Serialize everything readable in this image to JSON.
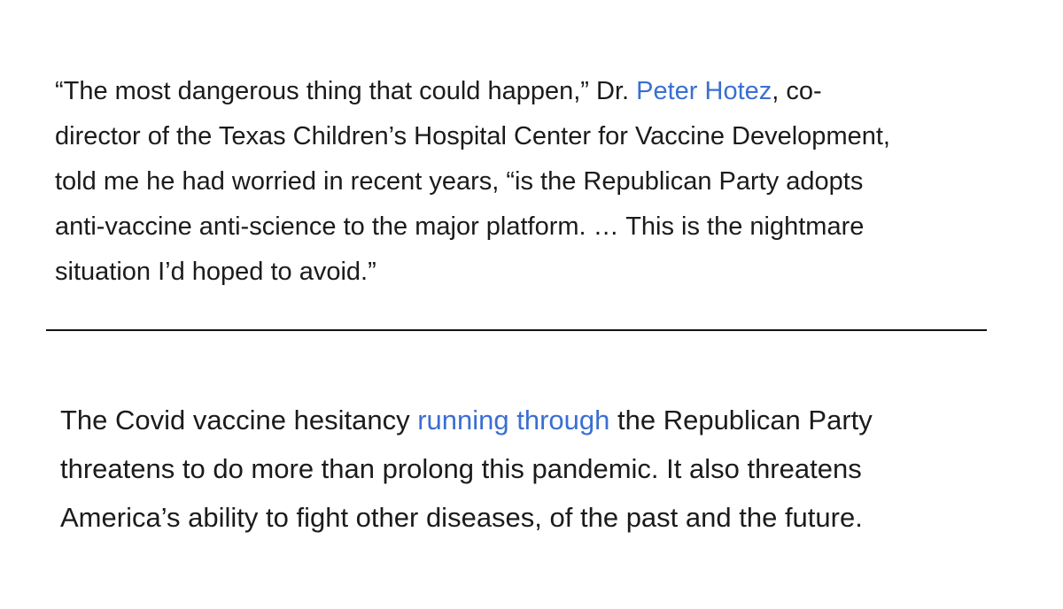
{
  "quote_paragraph": {
    "line1": {
      "before_link": "“The most dangerous thing that could happen,” Dr. ",
      "link": "Peter Hotez",
      "after_link": ", co-"
    },
    "line2": "director of the Texas Children’s Hospital Center for Vaccine Development,",
    "line3": "told me he had worried in recent years, “is the Republican Party adopts",
    "line4": "anti-vaccine anti-science to the major platform. … This is the nightmare",
    "line5": "situation I’d hoped to avoid.”"
  },
  "body_paragraph": {
    "line1": {
      "before_link": "The Covid vaccine hesitancy ",
      "link": "running through",
      "after_link": " the Republican Party"
    },
    "line2": "threatens to do more than prolong this pandemic. It also threatens",
    "line3": "America’s ability to fight other diseases, of the past and the future."
  },
  "colors": {
    "text": "#1b1b1b",
    "link": "#3a6fd1",
    "divider": "#111111",
    "background": "#ffffff"
  }
}
